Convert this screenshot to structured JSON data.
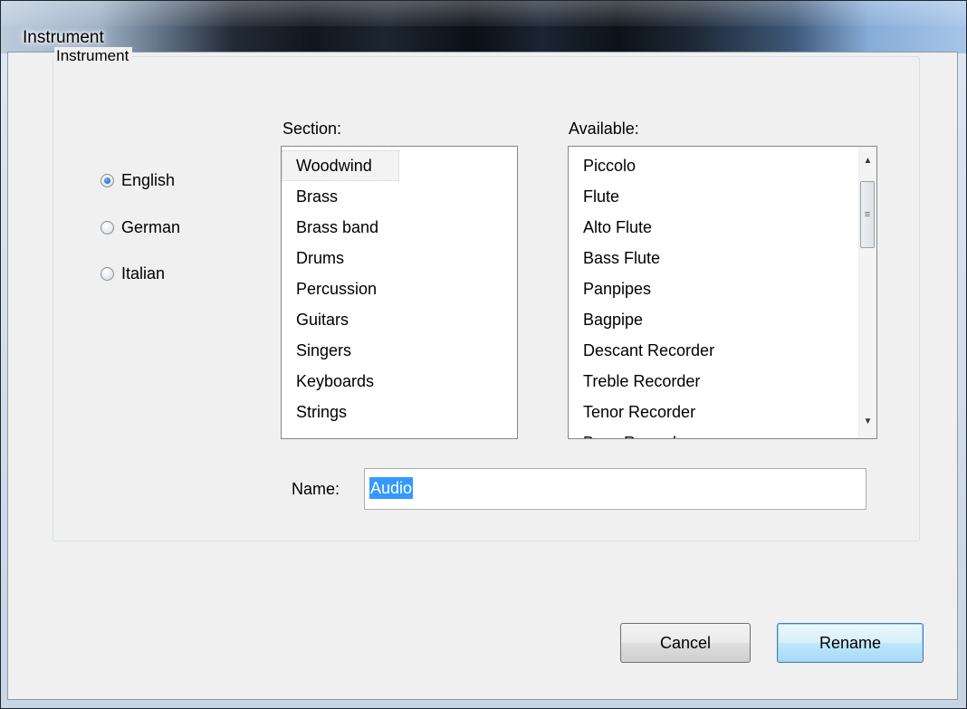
{
  "window": {
    "title": "Instrument"
  },
  "group": {
    "caption": "Instrument",
    "languages": [
      {
        "label": "English",
        "checked": true
      },
      {
        "label": "German",
        "checked": false
      },
      {
        "label": "Italian",
        "checked": false
      }
    ]
  },
  "section": {
    "label": "Section:",
    "items": [
      "Woodwind",
      "Brass",
      "Brass band",
      "Drums",
      "Percussion",
      "Guitars",
      "Singers",
      "Keyboards",
      "Strings"
    ],
    "selected": "Woodwind"
  },
  "available": {
    "label": "Available:",
    "items": [
      "Piccolo",
      "Flute",
      "Alto Flute",
      "Bass Flute",
      "Panpipes",
      "Bagpipe",
      "Descant Recorder",
      "Treble Recorder",
      "Tenor Recorder",
      "Bass Recorder"
    ]
  },
  "name_field": {
    "label": "Name:",
    "value": "Audio"
  },
  "buttons": {
    "cancel": "Cancel",
    "rename": "Rename"
  },
  "icons": {
    "scroll_up": "scroll-up-arrow-icon",
    "scroll_down": "scroll-down-arrow-icon",
    "grip": "scrollbar-grip-icon"
  }
}
